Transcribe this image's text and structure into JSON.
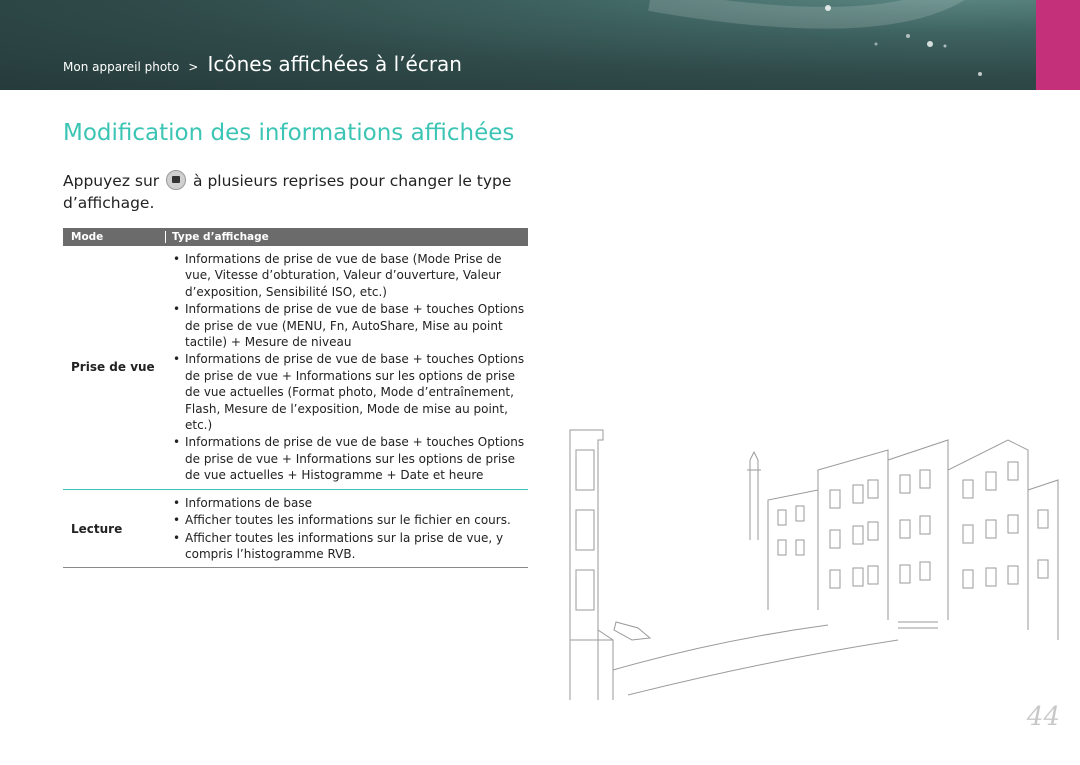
{
  "header": {
    "breadcrumb_parent": "Mon appareil photo",
    "breadcrumb_sep": ">",
    "breadcrumb_current": "Icônes affichées à l’écran"
  },
  "title": "Modification des informations affichées",
  "intro": {
    "before": "Appuyez sur",
    "after": "à plusieurs reprises pour changer le type d’affichage."
  },
  "table": {
    "headers": [
      "Mode",
      "Type d’affichage"
    ],
    "rows": [
      {
        "mode": "Prise de vue",
        "items": [
          "Informations de prise de vue de base (Mode Prise de vue, Vitesse d’obturation, Valeur d’ouverture, Valeur d’exposition, Sensibilité ISO, etc.)",
          "Informations de prise de vue de base + touches Options de prise de vue (MENU, Fn, AutoShare, Mise au point tactile) + Mesure de niveau",
          "Informations de prise de vue de base + touches Options de prise de vue + Informations sur les options de prise de vue actuelles (Format photo, Mode d’entraînement, Flash, Mesure de l’exposition, Mode de mise au point, etc.)",
          "Informations de prise de vue de base + touches Options de prise de vue + Informations sur les options de prise de vue actuelles + Histogramme + Date et heure"
        ]
      },
      {
        "mode": "Lecture",
        "items": [
          "Informations de base",
          "Afficher toutes les informations sur le fichier en cours.",
          "Afficher toutes les informations sur la prise de vue, y compris l’histogramme RVB."
        ]
      }
    ]
  },
  "page_number": "44",
  "icons": {
    "display_button": "display-button-icon"
  },
  "colors": {
    "accent": "#3cc4b4",
    "side_tab": "#c4307a",
    "header_bg": "#2f4a49"
  }
}
